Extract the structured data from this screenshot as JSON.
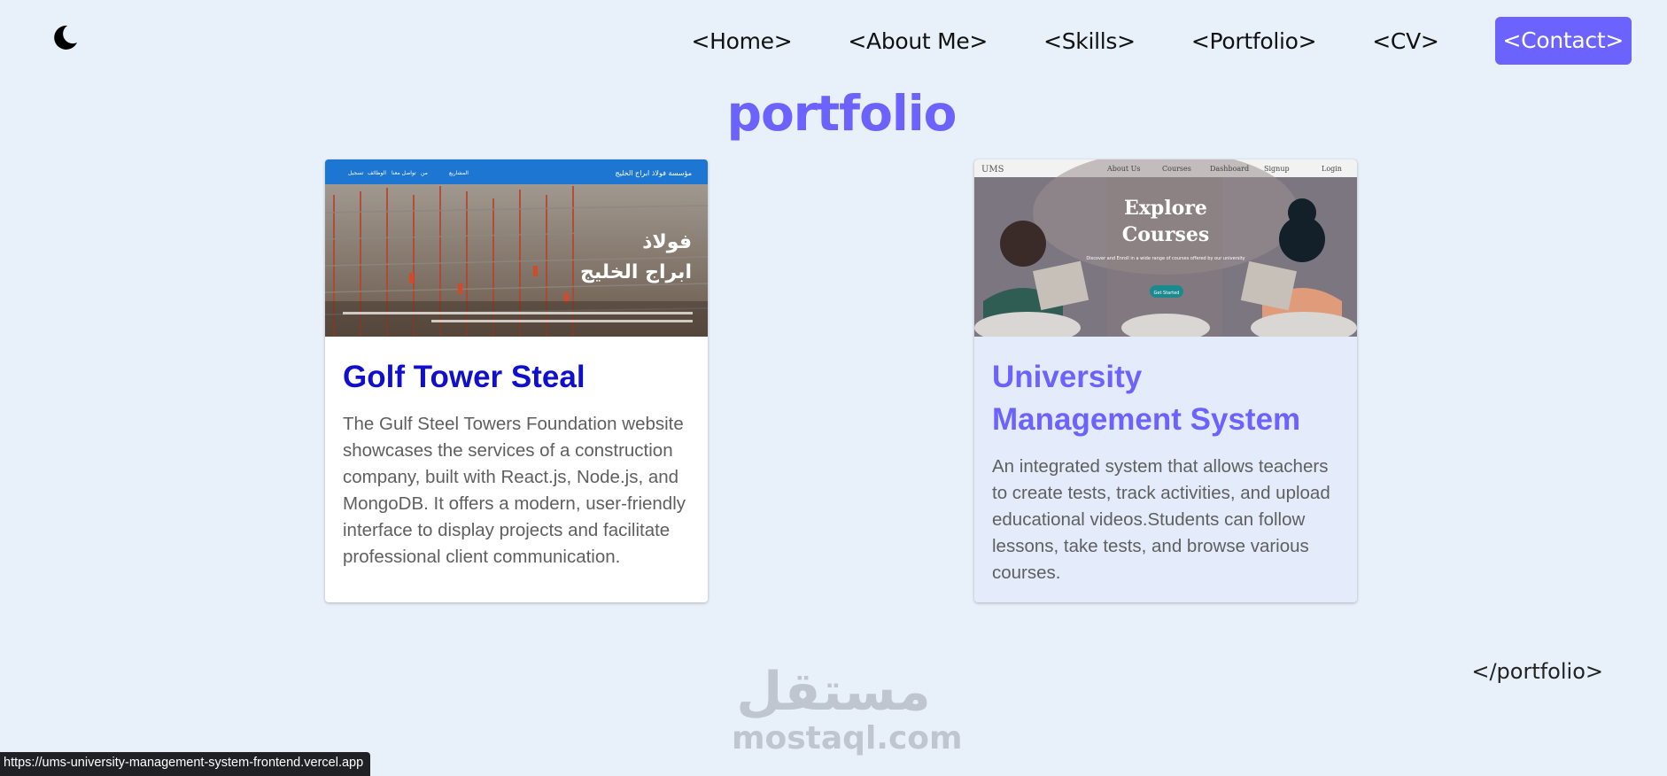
{
  "colors": {
    "background": "#e8f0fa",
    "accent": "#6c63ff",
    "link_blue": "#1010cc",
    "muted_text": "#5f5f5f"
  },
  "header": {
    "theme_icon": "moon-icon",
    "nav": [
      {
        "label": "<Home>"
      },
      {
        "label": "<About Me>"
      },
      {
        "label": "<Skills>"
      },
      {
        "label": "<Portfolio>"
      },
      {
        "label": "<CV>"
      },
      {
        "label": "<Contact>",
        "active": true
      }
    ]
  },
  "section": {
    "title": "portfolio",
    "closing_tag": "</portfolio>"
  },
  "projects": [
    {
      "title": "Golf Tower Steal",
      "description": "The Gulf Steel Towers Foundation website showcases the services of a construction company, built with React.js, Node.js, and MongoDB. It offers a modern, user-friendly interface to display projects and facilitate professional client communication.",
      "thumbnail": {
        "brand": "مؤسسة فولاذ ابراج الخليج",
        "nav": [
          "المشاريع",
          "من",
          "تواصل معنا",
          "الوظائف",
          "تسجيل"
        ],
        "headline_line1": "فولاذ",
        "headline_line2": "ابراج الخليج"
      }
    },
    {
      "title": "University Management System",
      "description": "An integrated system that allows teachers to create tests, track activities, and upload educational videos.Students can follow lessons, take tests, and browse various courses.",
      "thumbnail": {
        "brand": "UMS",
        "nav": [
          "About Us",
          "Courses",
          "Dashboard",
          "Signup",
          "Login"
        ],
        "headline_line1": "Explore",
        "headline_line2": "Courses",
        "subtitle": "Discover and Enroll in a wide range of courses offered by our university",
        "cta": "Get Started"
      }
    }
  ],
  "watermark": {
    "arabic": "مستقل",
    "latin": "mostaql.com"
  },
  "status_bar": {
    "url": "https://ums-university-management-system-frontend.vercel.app"
  }
}
